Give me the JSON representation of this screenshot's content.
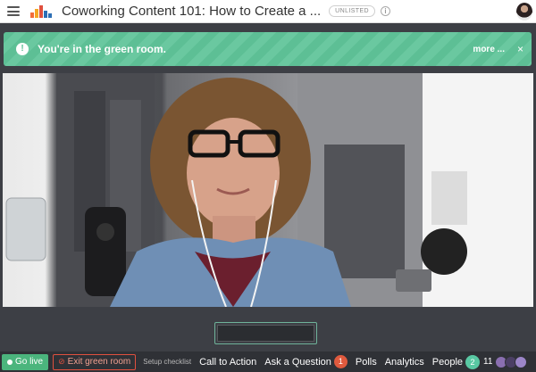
{
  "header": {
    "title": "Coworking Content 101: How to Create a ...",
    "badge": "UNLISTED",
    "info_icon": "info-icon",
    "logo_colors": [
      "#f26b3a",
      "#f5a623",
      "#e0503e",
      "#2d6fb5"
    ]
  },
  "banner": {
    "message": "You're in the green room.",
    "more_label": "more ...",
    "close_label": "×",
    "alert_glyph": "!",
    "color": "#5dbf95"
  },
  "video": {
    "description_icon": "camera-feed"
  },
  "bottom": {
    "go_live_label": "Go live",
    "exit_label": "Exit green room",
    "setup_label": "Setup checklist",
    "nav": {
      "call_to_action": "Call to Action",
      "ask_question": "Ask a Question",
      "ask_count": "1",
      "polls": "Polls",
      "analytics": "Analytics",
      "people": "People",
      "people_count": "2",
      "viewer_count": "11"
    },
    "colors": {
      "go_live": "#4bb57d",
      "exit": "#e0503e",
      "count_red": "#e05a3e",
      "count_green": "#59c8a3"
    }
  }
}
